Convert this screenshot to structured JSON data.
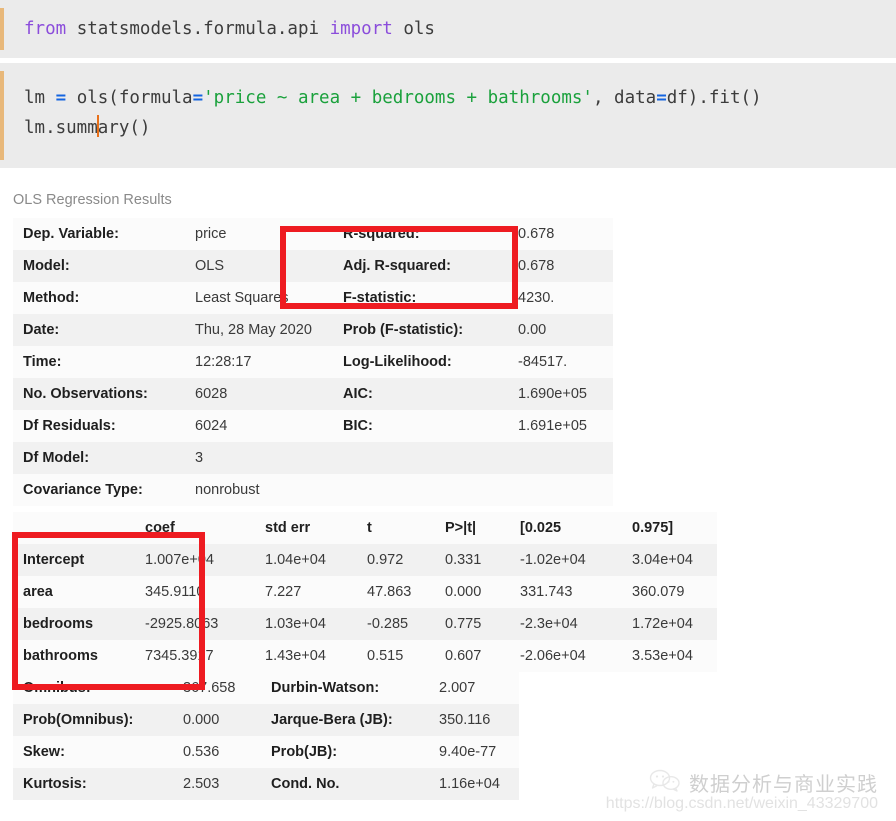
{
  "notebook": {
    "cells": [
      {
        "id": "cell-1",
        "tokens": [
          {
            "t": "from ",
            "c": "kw"
          },
          {
            "t": "statsmodels.formula.api ",
            "c": "plain"
          },
          {
            "t": "import ",
            "c": "kw"
          },
          {
            "t": "ols",
            "c": "plain"
          }
        ],
        "line_text": "from statsmodels.formula.api import ols"
      },
      {
        "id": "cell-2",
        "line_text": "lm = ols(formula='price ~ area + bedrooms + bathrooms', data=df).fit()",
        "line2_text": "lm.summary()"
      }
    ]
  },
  "output": {
    "title": "OLS Regression Results",
    "summary_rows": [
      [
        "Dep. Variable:",
        "price",
        "R-squared:",
        "0.678"
      ],
      [
        "Model:",
        "OLS",
        "Adj. R-squared:",
        "0.678"
      ],
      [
        "Method:",
        "Least Squares",
        "F-statistic:",
        "4230."
      ],
      [
        "Date:",
        "Thu, 28 May 2020",
        "Prob (F-statistic):",
        "0.00"
      ],
      [
        "Time:",
        "12:28:17",
        "Log-Likelihood:",
        "-84517."
      ],
      [
        "No. Observations:",
        "6028",
        "AIC:",
        "1.690e+05"
      ],
      [
        "Df Residuals:",
        "6024",
        "BIC:",
        "1.691e+05"
      ],
      [
        "Df Model:",
        "3",
        "",
        ""
      ],
      [
        "Covariance Type:",
        "nonrobust",
        "",
        ""
      ]
    ],
    "coef_headers": [
      "",
      "coef",
      "std err",
      "t",
      "P>|t|",
      "[0.025",
      "0.975]"
    ],
    "coef_rows": [
      [
        "Intercept",
        "1.007e+04",
        "1.04e+04",
        "0.972",
        "0.331",
        "-1.02e+04",
        "3.04e+04"
      ],
      [
        "area",
        "345.9110",
        "7.227",
        "47.863",
        "0.000",
        "331.743",
        "360.079"
      ],
      [
        "bedrooms",
        "-2925.8063",
        "1.03e+04",
        "-0.285",
        "0.775",
        "-2.3e+04",
        "1.72e+04"
      ],
      [
        "bathrooms",
        "7345.3917",
        "1.43e+04",
        "0.515",
        "0.607",
        "-2.06e+04",
        "3.53e+04"
      ]
    ],
    "diag_rows": [
      [
        "Omnibus:",
        "367.658",
        "Durbin-Watson:",
        "2.007"
      ],
      [
        "Prob(Omnibus):",
        "0.000",
        "Jarque-Bera (JB):",
        "350.116"
      ],
      [
        "Skew:",
        "0.536",
        "Prob(JB):",
        "9.40e-77"
      ],
      [
        "Kurtosis:",
        "2.503",
        "Cond. No.",
        "1.16e+04"
      ]
    ]
  },
  "annotations": {
    "color": "#ee1b21",
    "boxes": [
      {
        "name": "redbox-rsquared",
        "covers": "R-squared / Adj. R-squared"
      },
      {
        "name": "redbox-coef",
        "covers": "coef column"
      }
    ]
  },
  "watermark": {
    "brand": "数据分析与商业实践",
    "url": "https://blog.csdn.net/weixin_43329700"
  }
}
